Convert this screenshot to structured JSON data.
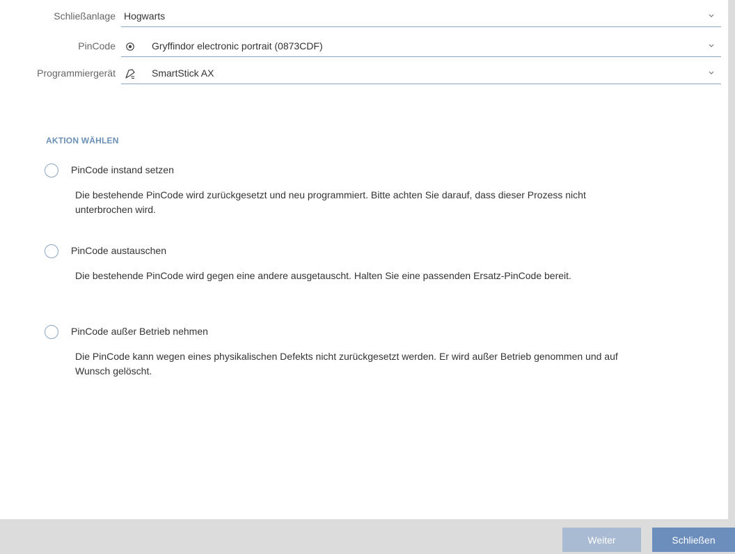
{
  "form": {
    "locking_system": {
      "label": "Schließanlage",
      "value": "Hogwarts"
    },
    "pincode": {
      "label": "PinCode",
      "icon": "pincode-icon",
      "value": "Gryffindor electronic portrait (0873CDF)"
    },
    "programmer": {
      "label": "Programmiergerät",
      "icon": "smartstick-icon",
      "value": "SmartStick AX"
    }
  },
  "action": {
    "title": "AKTION WÄHLEN",
    "options": [
      {
        "label": "PinCode instand setzen",
        "description": "Die bestehende PinCode wird zurückgesetzt und neu programmiert. Bitte achten Sie darauf, dass dieser Prozess nicht unterbrochen wird."
      },
      {
        "label": "PinCode austauschen",
        "description": "Die bestehende PinCode wird gegen eine andere ausgetauscht. Halten Sie eine passenden Ersatz-PinCode bereit."
      },
      {
        "label": "PinCode außer Betrieb nehmen",
        "description": "Die PinCode kann wegen eines physikalischen Defekts nicht zurückgesetzt werden. Er wird außer Betrieb genommen und auf Wunsch gelöscht."
      }
    ]
  },
  "footer": {
    "next_label": "Weiter",
    "close_label": "Schließen"
  },
  "colors": {
    "accent": "#6c8ebd",
    "accent_disabled": "#a9bbd3",
    "section_title": "#6b8fb5",
    "footer_bg": "#dcdcdc"
  }
}
